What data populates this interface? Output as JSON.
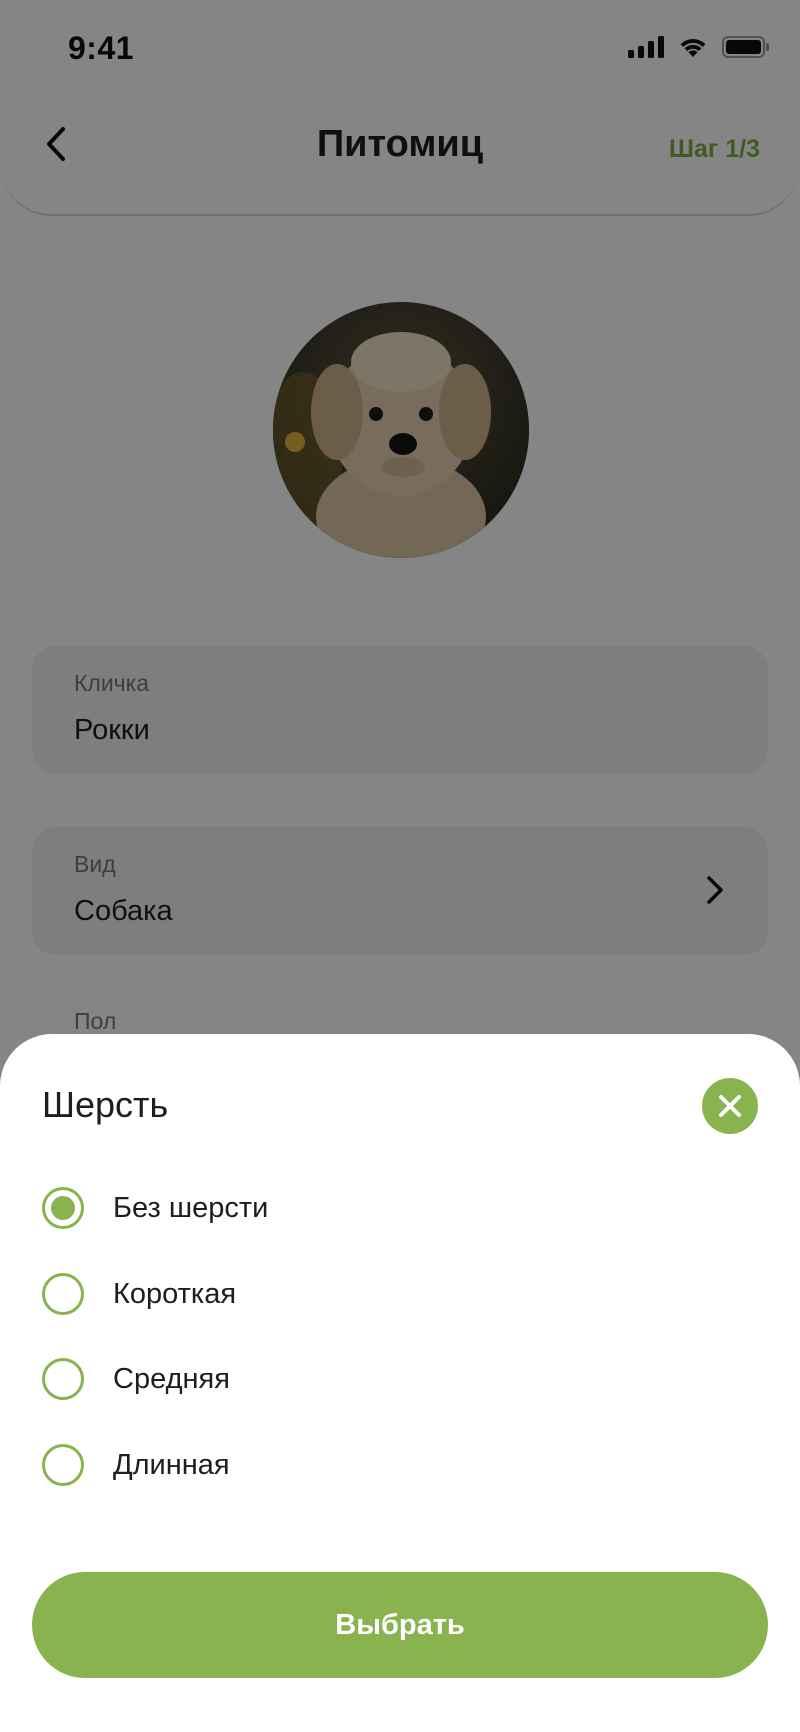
{
  "status_bar": {
    "time": "9:41",
    "icons": [
      "signal-icon",
      "wifi-icon",
      "battery-icon"
    ]
  },
  "header": {
    "back_icon": "chevron-left-icon",
    "title": "Питомиц",
    "step": "Шаг 1/3"
  },
  "avatar": {
    "description_icon": "pet-photo"
  },
  "form": {
    "name_label": "Кличка",
    "name_value": "Рокки",
    "species_label": "Вид",
    "species_value": "Собака",
    "sex_label": "Пол"
  },
  "sheet": {
    "title": "Шерсть",
    "close_icon": "close-icon",
    "options": [
      {
        "label": "Без шерсти",
        "selected": true
      },
      {
        "label": "Короткая",
        "selected": false
      },
      {
        "label": "Средняя",
        "selected": false
      },
      {
        "label": "Длинная",
        "selected": false
      }
    ],
    "submit_label": "Выбрать"
  },
  "colors": {
    "accent": "#88b34f",
    "step_text": "#7fad45",
    "field_bg": "#f2f2f2",
    "overlay": "rgba(0,0,0,0.48)"
  }
}
